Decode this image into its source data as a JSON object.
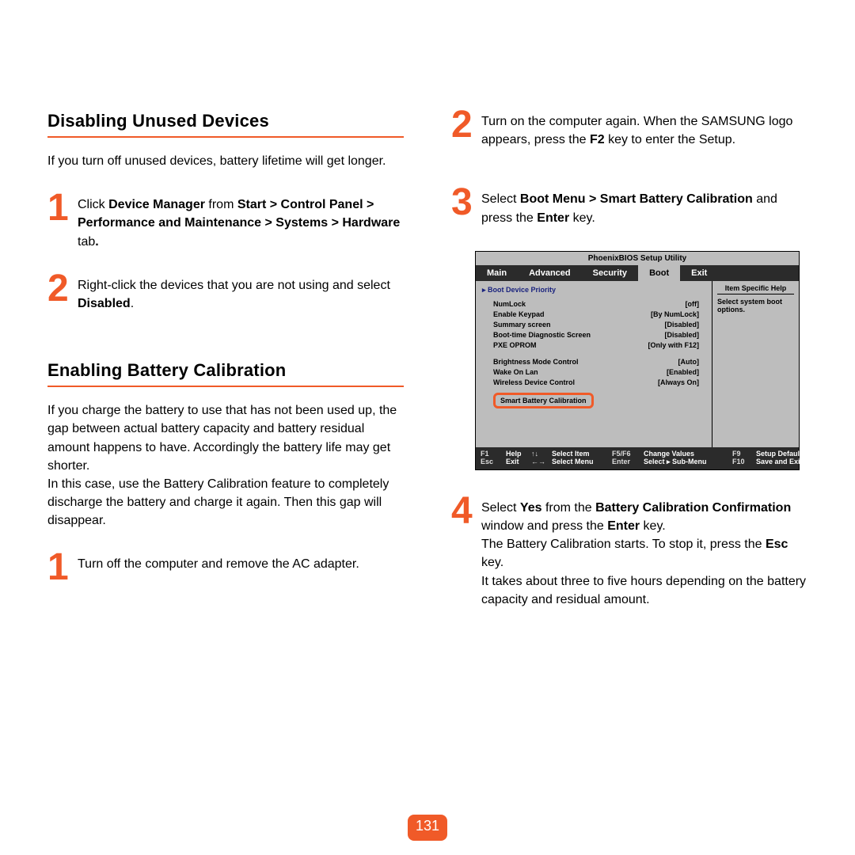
{
  "page_number": "131",
  "left": {
    "section1": {
      "heading": "Disabling Unused Devices",
      "intro": "If you turn off unused devices, battery lifetime will get longer.",
      "step1_html": "Click <b>Device Manager</b> from <b>Start > Control Panel > Performance and Maintenance > Systems > Hardware</b> tab<b>.</b>",
      "step2_html": "Right-click the devices that you are not using and select <b>Disabled</b>."
    },
    "section2": {
      "heading": "Enabling Battery Calibration",
      "intro": "If you charge the battery to use that has not been used up, the gap between actual battery capacity and battery residual amount happens to have. Accordingly the battery life may get shorter.\nIn this case, use the Battery Calibration feature to completely discharge the battery and charge it again. Then this gap will disappear.",
      "step1": "Turn off the computer and remove the AC adapter."
    }
  },
  "right": {
    "step2_html": "Turn on the computer again. When the SAMSUNG logo appears, press the <b>F2</b> key to enter the Setup.",
    "step3_html": "Select <b>Boot Menu > Smart Battery Calibration</b> and press the <b>Enter</b> key.",
    "step4_html": "Select <b>Yes</b> from the <b>Battery Calibration Confirmation</b> window and press the <b>Enter</b> key.<br>The Battery Calibration starts. To stop it, press the <b>Esc</b> key.<br>It takes about three to five hours depending on the battery capacity and residual amount."
  },
  "bios": {
    "title": "PhoenixBIOS Setup Utility",
    "menu": [
      "Main",
      "Advanced",
      "Security",
      "Boot",
      "Exit"
    ],
    "active_tab": "Boot",
    "bootdev": "▸ Boot Device Priority",
    "rows": [
      {
        "k": "NumLock",
        "v": "[off]"
      },
      {
        "k": "Enable Keypad",
        "v": "[By NumLock]"
      },
      {
        "k": "Summary screen",
        "v": "[Disabled]"
      },
      {
        "k": "Boot-time Diagnostic Screen",
        "v": "[Disabled]"
      },
      {
        "k": "PXE OPROM",
        "v": "[Only with F12]"
      }
    ],
    "rows2": [
      {
        "k": "Brightness Mode Control",
        "v": "[Auto]"
      },
      {
        "k": "Wake On Lan",
        "v": "[Enabled]"
      },
      {
        "k": "Wireless Device Control",
        "v": "[Always On]"
      }
    ],
    "selected": "Smart Battery Calibration",
    "help_header": "Item Specific Help",
    "help_text": "Select system boot options.",
    "footer": {
      "r1": {
        "k1": "F1",
        "l1": "Help",
        "a1": "↑↓",
        "l2": "Select Item",
        "k2": "F5/F6",
        "l3": "Change Values",
        "k3": "F9",
        "l4": "Setup Defaults"
      },
      "r2": {
        "k1": "Esc",
        "l1": "Exit",
        "a1": "←→",
        "l2": "Select Menu",
        "k2": "Enter",
        "l3": "Select ▸ Sub-Menu",
        "k3": "F10",
        "l4": "Save and Exit"
      }
    }
  },
  "nums": {
    "n1": "1",
    "n2": "2",
    "n3": "3",
    "n4": "4"
  }
}
